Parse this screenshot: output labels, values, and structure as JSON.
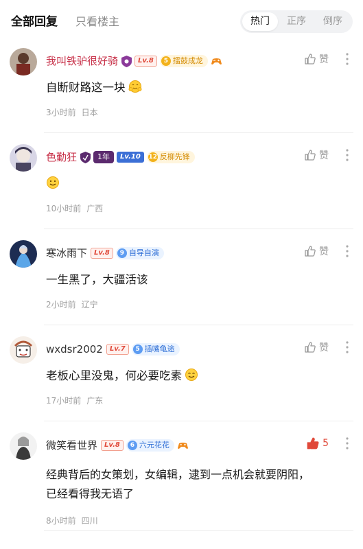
{
  "header": {
    "tab_all": "全部回复",
    "tab_op_only": "只看楼主",
    "sort": [
      "热门",
      "正序",
      "倒序"
    ]
  },
  "colors": {
    "accent_red": "#c8324a",
    "like_active": "#e0493a",
    "meta_gray": "#a0a0a0"
  },
  "comments": [
    {
      "username": "我叫铁驴很好骑",
      "level": "Lv.8",
      "medal_num": "5",
      "medal": "擂鼓成龙",
      "content": "自断财路这一块",
      "emoji": "hug-emoji",
      "time": "3小时前",
      "location": "日本",
      "like_label": "赞"
    },
    {
      "username": "色勤狂",
      "year_badge": "1年",
      "level": "Lv.10",
      "medal_num": "12",
      "medal": "反柳先锋",
      "content": "",
      "emoji": "smile-emoji",
      "time": "10小时前",
      "location": "广西",
      "like_label": "赞"
    },
    {
      "username": "寒冰雨下",
      "level": "Lv.8",
      "medal_num": "9",
      "medal": "自导自演",
      "content": "一生黑了，大疆活该",
      "time": "2小时前",
      "location": "辽宁",
      "like_label": "赞"
    },
    {
      "username": "wxdsr2002",
      "level": "Lv.7",
      "medal_num": "5",
      "medal": "插嘴龟途",
      "content": "老板心里没鬼，何必要吃素",
      "emoji": "smile-emoji",
      "time": "17小时前",
      "location": "广东",
      "like_label": "赞"
    },
    {
      "username": "微笑看世界",
      "level": "Lv.8",
      "medal_num": "6",
      "medal": "六元花花",
      "content_line1": "经典背后的女策划，女编辑，逮到一点机会就要阴阳，",
      "content_line2": "已经看得我无语了",
      "time": "8小时前",
      "location": "四川",
      "like_count": "5"
    }
  ]
}
